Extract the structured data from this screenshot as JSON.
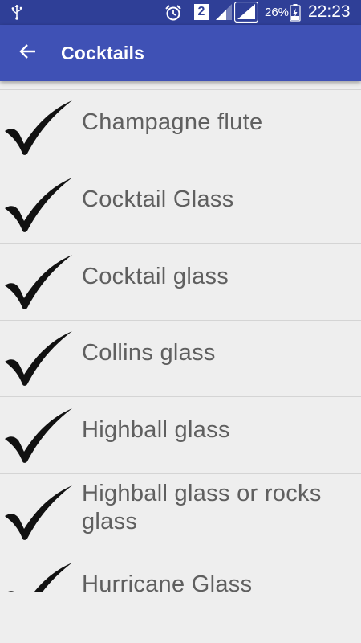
{
  "status_bar": {
    "usb_icon": "usb-icon",
    "alarm_icon": "alarm-clock-icon",
    "sim_badge": "2",
    "signal_icons": [
      "signal-icon",
      "signal-icon"
    ],
    "battery_percent": "26%",
    "battery_icon": "battery-charging-icon",
    "time": "22:23",
    "background_color": "#2f3f97"
  },
  "app_bar": {
    "back_icon": "arrow-left-icon",
    "title": "Cocktails",
    "background_color": "#3f51b5"
  },
  "list": {
    "item_icon": "checkmark-icon",
    "items": [
      {
        "label": "Champagne flute"
      },
      {
        "label": "Cocktail Glass"
      },
      {
        "label": "Cocktail glass"
      },
      {
        "label": "Collins glass"
      },
      {
        "label": "Highball glass"
      },
      {
        "label": "Highball glass or rocks glass"
      },
      {
        "label": "Hurricane Glass"
      }
    ]
  }
}
